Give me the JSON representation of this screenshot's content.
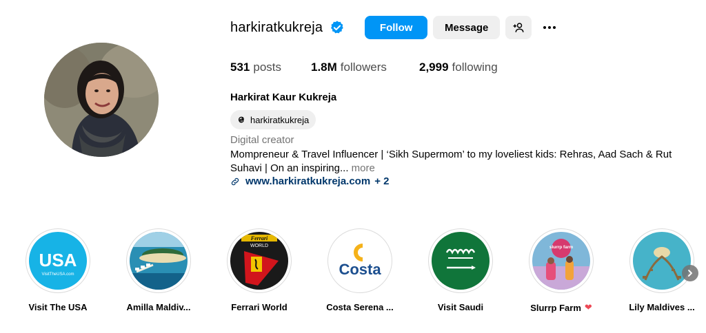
{
  "profile": {
    "username": "harkiratkukreja",
    "verified_icon": "verified-badge-icon",
    "buttons": {
      "follow": "Follow",
      "message": "Message"
    },
    "stats": {
      "posts_count": "531",
      "posts_label": "posts",
      "followers_count": "1.8M",
      "followers_label": "followers",
      "following_count": "2,999",
      "following_label": "following"
    },
    "full_name": "Harkirat Kaur Kukreja",
    "threads_handle": "harkiratkukreja",
    "category": "Digital creator",
    "bio_text": "Mompreneur & Travel Influencer | ‘Sikh Supermom’ to my loveliest kids: Rehras, Aad Sach & Rut Suhavi | On an inspiring...",
    "bio_more": "more",
    "website": "www.harkiratkukreja.com",
    "website_extra": "+ 2"
  },
  "highlights": [
    {
      "label": "Visit The USA",
      "image_text": "USA",
      "image_subtext": "VisitTheUSA.com"
    },
    {
      "label": "Amilla Maldiv..."
    },
    {
      "label": "Ferrari World",
      "image_text": "Ferrari",
      "image_subtext": "WORLD"
    },
    {
      "label": "Costa Serena ...",
      "image_text": "Costa"
    },
    {
      "label": "Visit Saudi"
    },
    {
      "label": "Slurrp Farm",
      "image_text": "slurrp farm"
    },
    {
      "label": "Lily Maldives ..."
    }
  ],
  "colors": {
    "follow_blue": "#0095f6",
    "secondary_button": "#efefef",
    "link_blue": "#00376b",
    "muted_text": "#737373",
    "heart_red": "#ed4956"
  }
}
